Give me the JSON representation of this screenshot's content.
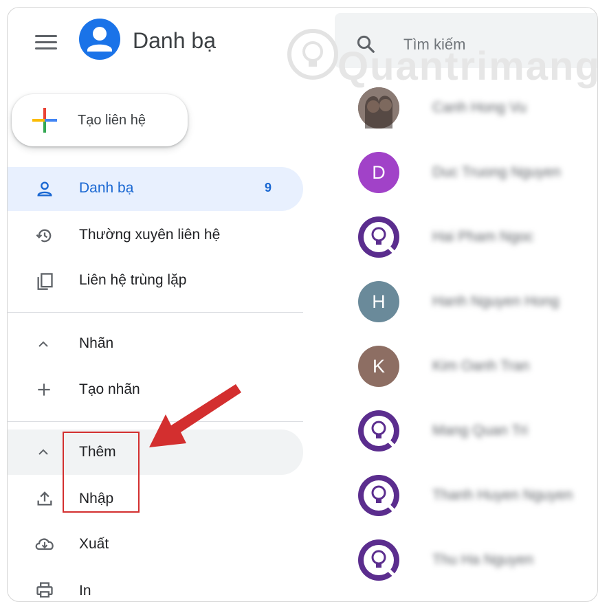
{
  "app": {
    "title": "Danh bạ"
  },
  "search": {
    "placeholder": "Tìm kiếm"
  },
  "create_button": {
    "label": "Tạo liên hệ"
  },
  "nav": {
    "contacts": {
      "label": "Danh bạ",
      "count": "9"
    },
    "frequent": {
      "label": "Thường xuyên liên hệ"
    },
    "duplicates": {
      "label": "Liên hệ trùng lặp"
    },
    "labels_header": {
      "label": "Nhãn"
    },
    "create_label": {
      "label": "Tạo nhãn"
    },
    "more": {
      "label": "Thêm"
    },
    "import": {
      "label": "Nhập"
    },
    "export": {
      "label": "Xuất"
    },
    "print": {
      "label": "In"
    }
  },
  "contacts": [
    {
      "name": "Canh Hong Vu",
      "avatar": "photo"
    },
    {
      "name": "Duc Truong Nguyen",
      "avatar": "letter",
      "letter": "D",
      "color": "#a142c8"
    },
    {
      "name": "Hai Pham Ngoc",
      "avatar": "logo"
    },
    {
      "name": "Hanh Nguyen Hong",
      "avatar": "letter",
      "letter": "H",
      "color": "#6a8a9a"
    },
    {
      "name": "Kim Oanh Tran",
      "avatar": "letter",
      "letter": "K",
      "color": "#8d6e63"
    },
    {
      "name": "Mang Quan Tri",
      "avatar": "logo"
    },
    {
      "name": "Thanh Huyen Nguyen",
      "avatar": "logo"
    },
    {
      "name": "Thu Ha Nguyen",
      "avatar": "logo"
    }
  ],
  "watermark": {
    "text": "Quantrimang"
  },
  "colors": {
    "accent": "#1a73e8",
    "active_bg": "#e8f0fe",
    "highlight": "#d32f2f"
  }
}
